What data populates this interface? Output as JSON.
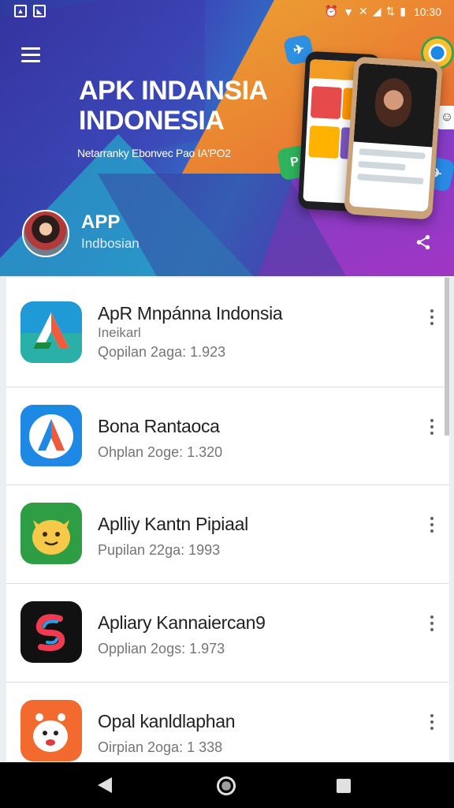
{
  "status_bar": {
    "time": "10:30",
    "left_icons": [
      "image-notification-icon",
      "app-notification-icon"
    ],
    "right_icons": [
      "alarm-icon",
      "wifi-icon",
      "vibrate-icon",
      "signal-icon",
      "data-icon",
      "battery-icon"
    ]
  },
  "hero": {
    "title_line1": "APK INDANSIA",
    "title_line2": "INDONESIA",
    "subtitle": "Netarranky Ebonvec Pao IA'PO2",
    "app_name": "APP",
    "app_sub": "Indbosian",
    "menu_icon": "hamburger-menu-icon",
    "share_icon": "share-icon"
  },
  "apps": [
    {
      "title": "ApR Mnpánna Indonsia",
      "subtitle": "Ineikarl",
      "meta": "Qopilan 2aga: 1.923",
      "icon": "apk-a-icon",
      "color": "#1f9ad6"
    },
    {
      "title": "Bona Rantaoca",
      "subtitle": "",
      "meta": "Ohplan 2oge: 1.320",
      "icon": "compass-a-icon",
      "color": "#1e88e5"
    },
    {
      "title": "Aplliy Kantn Pipiaal",
      "subtitle": "",
      "meta": "Pupilan 22ga: 1993",
      "icon": "smiley-face-icon",
      "color": "#2e9d44"
    },
    {
      "title": "Apliary Kannaiercan9",
      "subtitle": "",
      "meta": "Opplian 2ogs: 1.973",
      "icon": "swirl-s-icon",
      "color": "#111111"
    },
    {
      "title": "Opal kanldlaphan",
      "subtitle": "",
      "meta": "Oirpian 2oga: 1 338",
      "icon": "cartoon-creature-icon",
      "color": "#f26a2e"
    }
  ],
  "nav": {
    "back": "back-icon",
    "home": "home-icon",
    "recents": "recents-icon"
  }
}
